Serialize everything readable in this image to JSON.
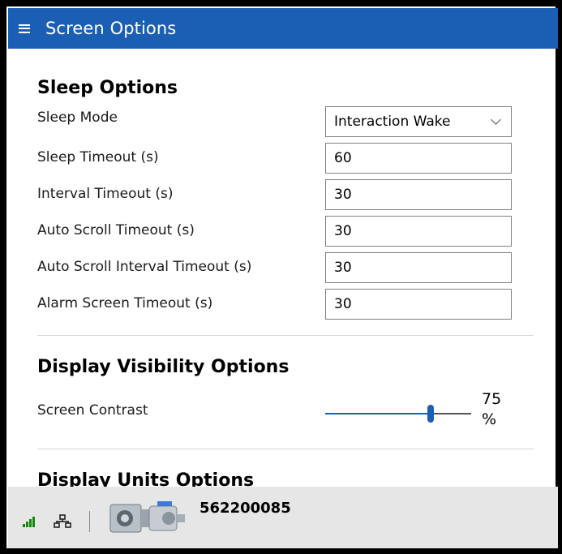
{
  "header": {
    "title": "Screen Options",
    "menu_icon": "hamburger-menu-icon",
    "accent": "#1a5fb4"
  },
  "sleep_options": {
    "title": "Sleep Options",
    "rows": [
      {
        "label": "Sleep Mode",
        "value": "Interaction Wake",
        "kind": "select"
      },
      {
        "label": "Sleep Timeout (s)",
        "value": "60",
        "kind": "input"
      },
      {
        "label": "Interval Timeout (s)",
        "value": "30",
        "kind": "input"
      },
      {
        "label": "Auto Scroll Timeout (s)",
        "value": "30",
        "kind": "input"
      },
      {
        "label": "Auto Scroll Interval Timeout (s)",
        "value": "30",
        "kind": "input"
      },
      {
        "label": "Alarm Screen Timeout (s)",
        "value": "30",
        "kind": "input"
      }
    ]
  },
  "display_visibility": {
    "title": "Display Visibility Options",
    "contrast_label": "Screen Contrast",
    "contrast_value": 75,
    "contrast_number": "75",
    "contrast_unit": "%"
  },
  "display_units": {
    "title": "Display Units Options"
  },
  "status_bar": {
    "signal_icon": "signal-strength-icon",
    "network_icon": "network-icon",
    "device_icon": "actuator-device-icon",
    "serial": "562200085",
    "signal_color": "#0f8a0f"
  }
}
